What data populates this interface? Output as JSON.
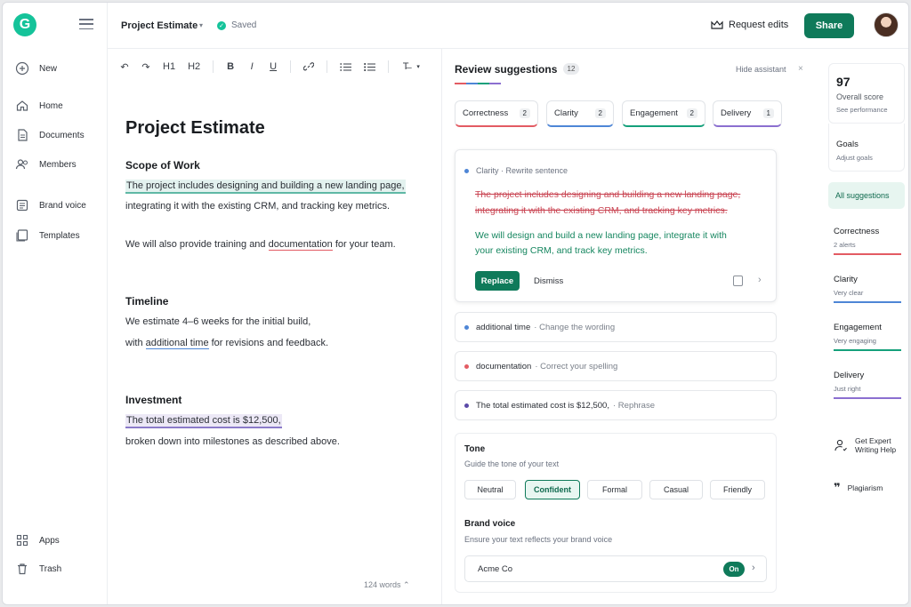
{
  "app": {
    "logo_letter": "G"
  },
  "sidebar": {
    "items": [
      {
        "label": "New",
        "icon": "plus-circle-icon"
      },
      {
        "label": "Home",
        "icon": "home-icon"
      },
      {
        "label": "Documents",
        "icon": "document-icon"
      },
      {
        "label": "Members",
        "icon": "members-icon"
      },
      {
        "label": "Brand voice",
        "icon": "brand-voice-icon"
      },
      {
        "label": "Templates",
        "icon": "templates-icon"
      },
      {
        "label": "Apps",
        "icon": "apps-grid-icon"
      },
      {
        "label": "Trash",
        "icon": "trash-icon"
      }
    ]
  },
  "header": {
    "doc_title": "Project Estimate",
    "status": "Saved",
    "request_edits": "Request edits",
    "share": "Share"
  },
  "toolbar": {
    "items": [
      "↶",
      "↷",
      "H1",
      "H2",
      "B",
      "I",
      "U",
      "🔗",
      "≔",
      "⋮≡",
      "T̶"
    ]
  },
  "editor": {
    "title": "Project Estimate",
    "sections": [
      {
        "heading": "Scope of Work"
      },
      {
        "heading": "Timeline"
      },
      {
        "heading": "Investment"
      }
    ],
    "scope_l1": "The project includes designing and building a new landing page,",
    "scope_l2": "integrating it with the existing CRM, and tracking key metrics.",
    "scope_l3_a": "We will also provide training and ",
    "scope_l3_b": "documentation",
    "scope_l3_c": " for your team.",
    "timeline_l1": "We estimate 4–6 weeks for the initial build,",
    "timeline_l2_a": "with ",
    "timeline_l2_b": "additional time",
    "timeline_l2_c": " for revisions and feedback.",
    "invest_l1": "The total estimated cost is $12,500,",
    "invest_l2": "broken down into milestones as described above.",
    "word_count": "124 words"
  },
  "review": {
    "title": "Review suggestions",
    "count": "12",
    "hide": "Hide assistant",
    "close": "×",
    "tabs": [
      {
        "label": "Correctness",
        "count": "2",
        "color": "#e35b63"
      },
      {
        "label": "Clarity",
        "count": "2",
        "color": "#4e86d6"
      },
      {
        "label": "Engagement",
        "count": "2",
        "color": "#15a07b"
      },
      {
        "label": "Delivery",
        "count": "1",
        "color": "#8b6fd0"
      }
    ],
    "main_card": {
      "category": "Clarity",
      "action": "Rewrite sentence",
      "old_l1": "The project includes designing and building a new landing page,",
      "old_l2": "integrating it with the existing CRM, and tracking key metrics.",
      "new_l1": "We will design and build a new landing page, integrate it with",
      "new_l2": "your existing CRM, and track key metrics.",
      "replace": "Replace",
      "dismiss": "Dismiss"
    },
    "mini_cards": [
      {
        "text": "additional time",
        "hint": "Change the wording",
        "color": "#4e86d6"
      },
      {
        "text": "documentation",
        "hint": "Correct your spelling",
        "color": "#e35b63"
      },
      {
        "text": "The total estimated cost is $12,500,",
        "hint": "Rephrase",
        "color": "#5b4aa8"
      }
    ],
    "tone": {
      "title": "Tone",
      "subtitle": "Guide the tone of your text",
      "options": [
        "Neutral",
        "Confident",
        "Formal",
        "Casual",
        "Friendly"
      ],
      "selected": "Confident"
    },
    "brand_voice": {
      "title": "Brand voice",
      "subtitle": "Ensure your text reflects your brand voice",
      "name": "Acme Co",
      "toggle": "On"
    }
  },
  "rail": {
    "score": "97",
    "score_label": "Overall score",
    "score_link": "See performance",
    "goals": "Goals",
    "goals_sub": "Adjust goals",
    "all": "All suggestions",
    "categories": [
      {
        "name": "Correctness",
        "status": "2 alerts",
        "color": "#e35b63"
      },
      {
        "name": "Clarity",
        "status": "Very clear",
        "color": "#4e86d6"
      },
      {
        "name": "Engagement",
        "status": "Very engaging",
        "color": "#15a07b"
      },
      {
        "name": "Delivery",
        "status": "Just right",
        "color": "#8b6fd0"
      }
    ],
    "expert": "Get Expert Writing Help",
    "expert_l1": "Get Expert",
    "expert_l2": "Writing Help",
    "plagiarism": "Plagiarism"
  }
}
